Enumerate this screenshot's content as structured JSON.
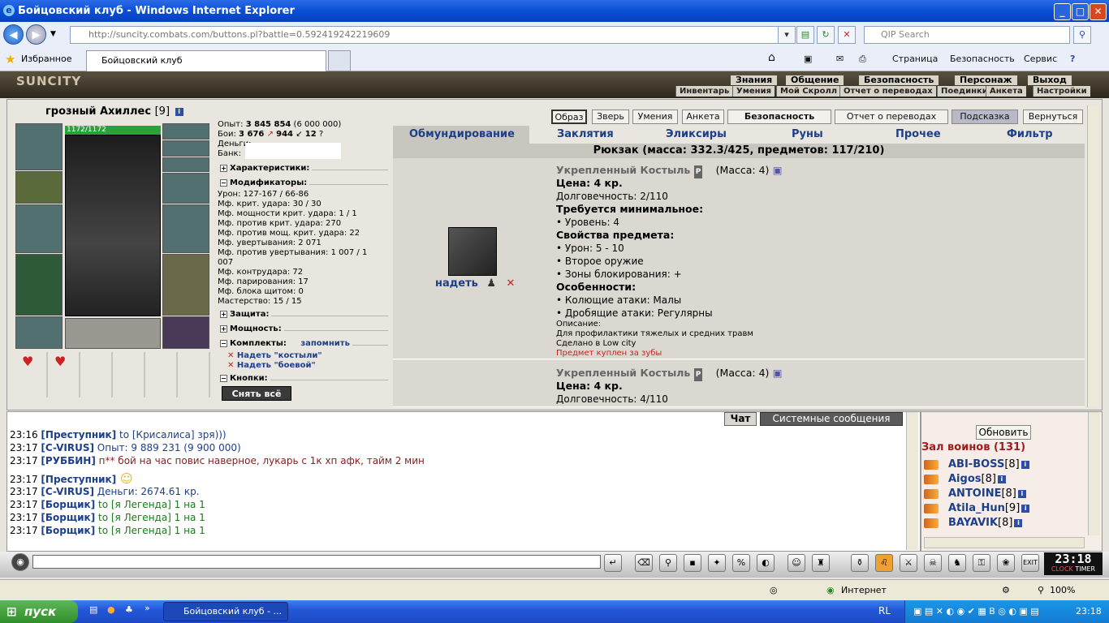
{
  "window": {
    "title": "Бойцовский клуб - Windows Internet Explorer",
    "min": "_",
    "max": "□",
    "close": "✕"
  },
  "address": {
    "url": "http://suncity.combats.com/buttons.pl?battle=0.592419242219609",
    "search_placeholder": "QIP Search"
  },
  "favbar": {
    "favorites": "Избранное",
    "tab_title": "Бойцовский клуб",
    "page_menu": "Страница",
    "safety_menu": "Безопасность",
    "service_menu": "Сервис"
  },
  "game": {
    "logo": "SUNCITY",
    "topmenu": [
      "Знания",
      "Общение",
      "Безопасность",
      "Персонаж",
      "Выход"
    ],
    "submenu": [
      "Инвентарь",
      "Умения",
      "Мой Скролл",
      "Отчет о переводах",
      "Поединки",
      "Анкета",
      "Настройки"
    ],
    "character": {
      "name": "грозный Ахиллес",
      "level": "[9]",
      "hp": "1172/1172"
    },
    "stats": {
      "exp_label": "Опыт:",
      "exp": "3 845 854",
      "exp_next": "(6 000 000)",
      "fights_label": "Бои:",
      "wins": "3 676",
      "losses": "944",
      "draws": "12",
      "money_label": "Деньги:",
      "bank_label": "Банк:"
    },
    "sections": {
      "characteristics": "Характеристики:",
      "modifiers": "Модификаторы:",
      "defense": "Защита:",
      "power": "Мощность:",
      "sets": "Комплекты:",
      "remember": "запомнить",
      "buttons": "Кнопки:"
    },
    "modifiers": [
      "Урон: 127-167 / 66-86",
      "Мф. крит. удара: 30 / 30",
      "Мф. мощности крит. удара: 1 / 1",
      "Мф. против крит. удара: 270",
      "Мф. против мощ. крит. удара: 22",
      "Мф. увертывания: 2 071",
      "Мф. против увертывания: 1 007 / 1",
      "007",
      "Мф. контрудара: 72",
      "Мф. парирования: 17",
      "Мф. блока щитом: 0",
      "Мастерство: 15 / 15"
    ],
    "sets": [
      "Надеть \"костыли\"",
      "Надеть \"боевой\""
    ],
    "undress_all": "Снять всё",
    "topbuttons": [
      "Образ",
      "Зверь",
      "Умения",
      "Анкета",
      "Безопасность",
      "Отчет о переводах",
      "Подсказка",
      "Вернуться"
    ],
    "inv_tabs": [
      "Обмундирование",
      "Заклятия",
      "Эликсиры",
      "Руны",
      "Прочее",
      "Фильтр"
    ],
    "rucksack": "Рюкзак (масса: 332.3/425, предметов: 117/210)",
    "item1": {
      "name": "Укрепленный Костыль",
      "mass": "(Масса: 4)",
      "price": "Цена: 4 кр.",
      "durability": "Долговечность: 2/110",
      "req_header": "Требуется минимальное:",
      "req": "• Уровень: 4",
      "props_header": "Свойства предмета:",
      "props": [
        "• Урон: 5 - 10",
        "• Второе оружие",
        "• Зоны блокирования: +"
      ],
      "features_header": "Особенности:",
      "features": [
        "• Колющие атаки: Малы",
        "• Дробящие атаки: Регулярны"
      ],
      "desc_label": "Описание:",
      "desc": "Для профилактики тяжелых и средних травм",
      "made": "Сделано в Low city",
      "bought": "Предмет куплен за зубы",
      "equip": "надеть"
    },
    "item2": {
      "name": "Укрепленный Костыль",
      "mass": "(Масса: 4)",
      "price": "Цена: 4 кр.",
      "durability": "Долговечность: 4/110"
    }
  },
  "chat": {
    "tabs": [
      "Чат",
      "Системные сообщения"
    ],
    "lines": [
      {
        "time": "23:16",
        "nick": "[Преступник]",
        "text": " to [Крисалиса] зря)))",
        "color": "#1c3f8a"
      },
      {
        "time": "23:17",
        "nick": "[C-VIRUS]",
        "text": " Опыт: 9 889 231 (9 900 000)",
        "color": "#1c3f8a"
      },
      {
        "time": "23:17",
        "nick": "[РУББИН]",
        "text": " п** бой на час повис наверное, лукарь с 1к хп афк, тайм 2 мин",
        "color": "#8a1c1c"
      },
      {
        "time": "23:17",
        "nick": "[Преступник]",
        "text": "",
        "color": "#1c3f8a"
      },
      {
        "time": "23:17",
        "nick": "[C-VIRUS]",
        "text": " Деньги: 2674.61 кр.",
        "color": "#1c3f8a"
      },
      {
        "time": "23:17",
        "nick": "[Борщик]",
        "text": " to [я Легенда] 1 на 1",
        "color": "#1a7a1a"
      },
      {
        "time": "23:17",
        "nick": "[Борщик]",
        "text": " to [я Легенда] 1 на 1",
        "color": "#1a7a1a"
      },
      {
        "time": "23:17",
        "nick": "[Борщик]",
        "text": " to [я Легенда] 1 на 1",
        "color": "#1a7a1a"
      }
    ]
  },
  "who": {
    "refresh": "Обновить",
    "title": "Зал воинов (131)",
    "users": [
      {
        "nick": "ABI-BOSS",
        "level": "[8]"
      },
      {
        "nick": "Aigos",
        "level": "[8]"
      },
      {
        "nick": "ANTOINE",
        "level": "[8]"
      },
      {
        "nick": "Atila_Hun",
        "level": "[9]"
      },
      {
        "nick": "BAYAVIK",
        "level": "[8]"
      }
    ]
  },
  "clock": {
    "time": "23:18",
    "label1": "CLOCK",
    "label2": "TIMER"
  },
  "status": {
    "zone": "Интернет",
    "zoom": "100%"
  },
  "taskbar": {
    "start": "пуск",
    "task": "Бойцовский клуб - ...",
    "lang": "RL",
    "time": "23:18"
  }
}
